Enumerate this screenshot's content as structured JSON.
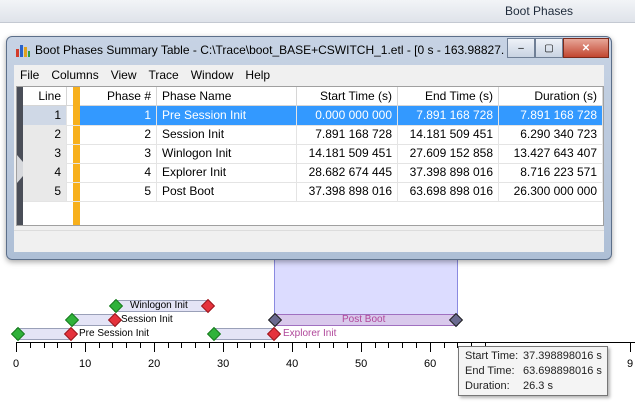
{
  "graph": {
    "title": "Boot Phases",
    "phases": [
      {
        "label": "Winlogon Init"
      },
      {
        "label": "Session Init"
      },
      {
        "label": "Pre Session Init"
      },
      {
        "label": "Post Boot"
      },
      {
        "label": "Explorer Init"
      }
    ],
    "axis_ticks": [
      "0",
      "10",
      "20",
      "30",
      "40",
      "50",
      "60",
      "9"
    ],
    "tooltip": {
      "start_key": "Start Time:",
      "start_val": "37.398898016 s",
      "end_key": "End Time:",
      "end_val": "63.698898016 s",
      "dur_key": "Duration:",
      "dur_val": "26.3 s"
    }
  },
  "window": {
    "title": "Boot Phases Summary Table - C:\\Trace\\boot_BASE+CSWITCH_1.etl - [0 s - 163.98827...",
    "buttons": {
      "minimize": "–",
      "maximize": "▢",
      "close": "✕"
    },
    "menu": [
      "File",
      "Columns",
      "View",
      "Trace",
      "Window",
      "Help"
    ],
    "table": {
      "headers": [
        "Line",
        "Phase #",
        "Phase Name",
        "Start Time (s)",
        "End Time (s)",
        "Duration (s)"
      ],
      "rows": [
        {
          "line": "1",
          "phase": "1",
          "name": "Pre Session Init",
          "start": "0.000 000 000",
          "end": "7.891 168 728",
          "duration": "7.891 168 728"
        },
        {
          "line": "2",
          "phase": "2",
          "name": "Session Init",
          "start": "7.891 168 728",
          "end": "14.181 509 451",
          "duration": "6.290 340 723"
        },
        {
          "line": "3",
          "phase": "3",
          "name": "Winlogon Init",
          "start": "14.181 509 451",
          "end": "27.609 152 858",
          "duration": "13.427 643 407"
        },
        {
          "line": "4",
          "phase": "4",
          "name": "Explorer Init",
          "start": "28.682 674 445",
          "end": "37.398 898 016",
          "duration": "8.716 223 571"
        },
        {
          "line": "5",
          "phase": "5",
          "name": "Post Boot",
          "start": "37.398 898 016",
          "end": "63.698 898 016",
          "duration": "26.300 000 000"
        }
      ]
    }
  }
}
